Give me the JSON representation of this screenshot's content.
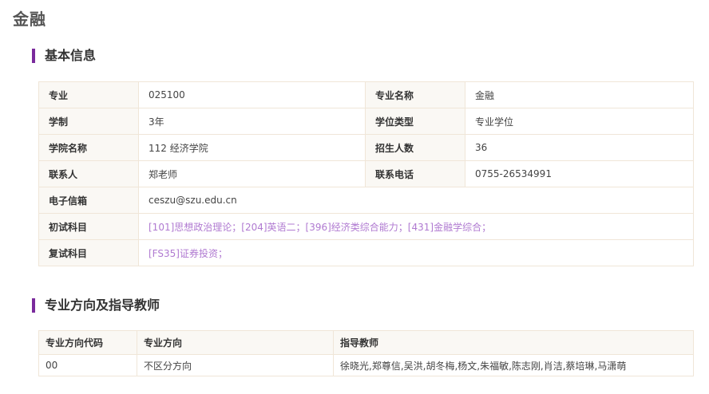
{
  "page": {
    "title": "金融"
  },
  "sections": {
    "basic_info": "基本信息",
    "directions": "专业方向及指导教师"
  },
  "info": {
    "major_code_label": "专业",
    "major_code": "025100",
    "major_name_label": "专业名称",
    "major_name": "金融",
    "duration_label": "学制",
    "duration": "3年",
    "degree_type_label": "学位类型",
    "degree_type": "专业学位",
    "college_label": "学院名称",
    "college": "112 经济学院",
    "enrollment_label": "招生人数",
    "enrollment": "36",
    "contact_label": "联系人",
    "contact": "郑老师",
    "phone_label": "联系电话",
    "phone": "0755-26534991",
    "email_label": "电子信箱",
    "email": "ceszu@szu.edu.cn",
    "prelim_label": "初试科目",
    "prelim_subjects": "[101]思想政治理论；[204]英语二；[396]经济类综合能力；[431]金融学综合；",
    "retest_label": "复试科目",
    "retest_subjects": "[FS35]证券投资；"
  },
  "directions_table": {
    "headers": [
      "专业方向代码",
      "专业方向",
      "指导教师"
    ],
    "rows": [
      [
        "00",
        "不区分方向",
        "徐晓光,郑尊信,吴洪,胡冬梅,杨文,朱福敏,陈志刚,肖洁,蔡培琳,马潇萌"
      ]
    ]
  },
  "colors": {
    "accent": "#7a2a9c",
    "subject_link": "#b07ad1",
    "border": "#f0e6d8",
    "label_bg": "#faf8f4"
  }
}
